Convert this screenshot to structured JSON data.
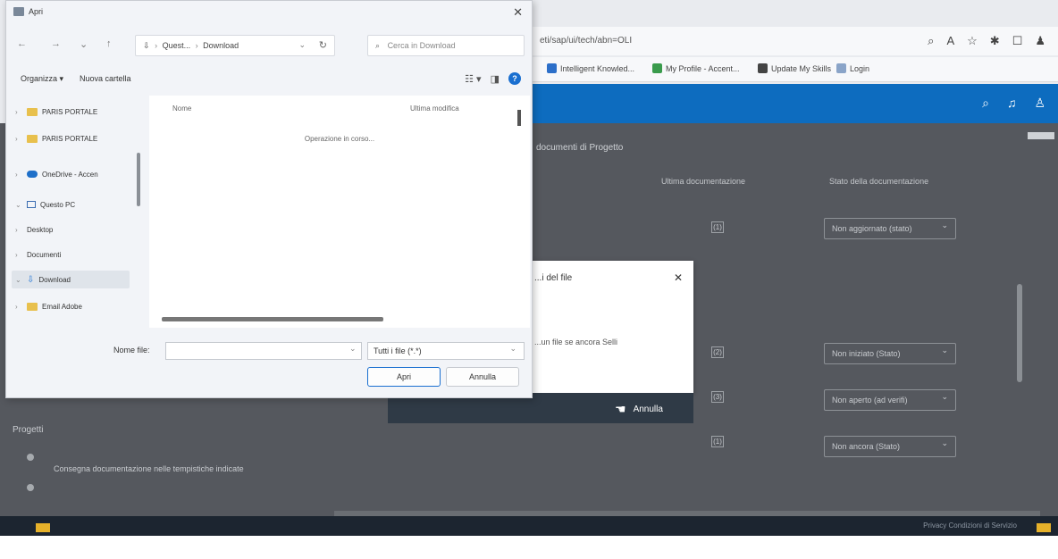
{
  "browser": {
    "url": "eti/sap/ui/tech/abn=OLI",
    "bookmarks": [
      {
        "label": "Intelligent Knowled...",
        "color": "#2c6fc9"
      },
      {
        "label": "My Profile - Accent...",
        "color": "#3a9b4c"
      },
      {
        "label": "Update My Skills",
        "color": "#444444"
      },
      {
        "label": "Login",
        "color": "#8aa4c8"
      }
    ],
    "toolbar_icons": [
      "zoom-icon",
      "read-aloud-icon",
      "favorite-icon",
      "extensions-icon",
      "split-icon",
      "profile-icon"
    ],
    "appbar_icons": [
      "search-icon",
      "bell-icon",
      "user-icon"
    ]
  },
  "page": {
    "section_title": "documenti di Progetto",
    "col_left": "Ultima documentazione",
    "col_right": "Stato della documentazione",
    "badges": [
      "(1)",
      "(2)",
      "(3)",
      "(1)"
    ],
    "selects": [
      "Non aggiornato (stato)",
      "Non iniziato (Stato)",
      "Non aperto (ad verifi)",
      "Non ancora (Stato)"
    ],
    "left_label": "Progetti",
    "left_line": "Consegna documentazione nelle tempistiche indicate",
    "footer": "Privacy   Condizioni di Servizio"
  },
  "upload_dialog": {
    "title": "...i del file",
    "message": "...un file se ancora Selli",
    "button": "Annulla"
  },
  "file_dialog": {
    "title": "Apri",
    "nav": {
      "back": "←",
      "forward": "→",
      "recent": "⌄",
      "up": "↑"
    },
    "breadcrumb": [
      "Quest...",
      "Download"
    ],
    "search_placeholder": "Cerca in Download",
    "organize": "Organizza ▾",
    "new_folder": "Nuova cartella",
    "tree": [
      {
        "label": "PARIS PORTALE",
        "type": "folder"
      },
      {
        "label": "PARIS PORTALE",
        "type": "folder"
      },
      {
        "label": "OneDrive - Accen",
        "type": "cloud"
      },
      {
        "label": "Questo PC",
        "type": "pc"
      },
      {
        "label": "Desktop",
        "type": "plain"
      },
      {
        "label": "Documenti",
        "type": "plain"
      },
      {
        "label": "Download",
        "type": "download"
      },
      {
        "label": "Email Adobe",
        "type": "folder"
      }
    ],
    "columns": {
      "name": "Nome",
      "modified": "Ultima modifica"
    },
    "loading": "Operazione in corso...",
    "filename_label": "Nome file:",
    "filename_value": "",
    "filetype": "Tutti i file (*.*)",
    "open_button": "Apri",
    "cancel_button": "Annulla"
  }
}
